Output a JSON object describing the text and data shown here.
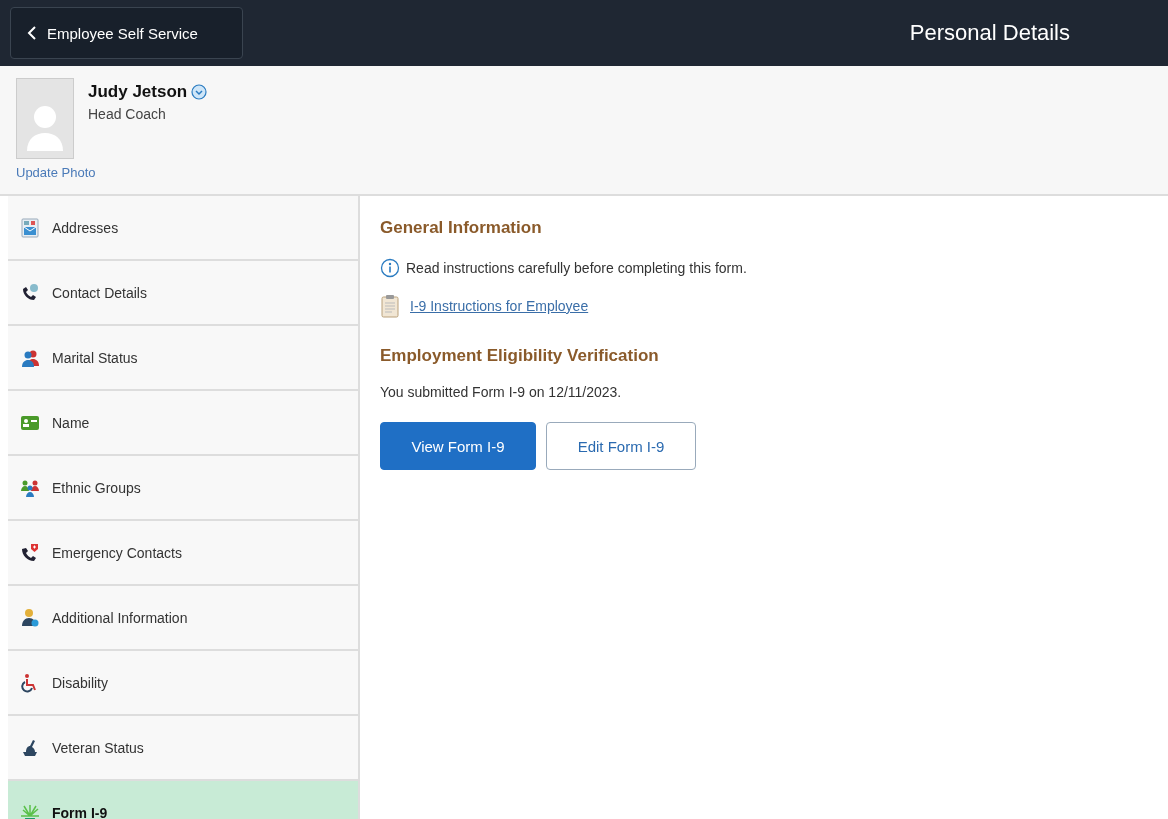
{
  "header": {
    "back_button": "Employee Self Service",
    "title": "Personal Details"
  },
  "profile": {
    "name": "Judy Jetson",
    "job_title": "Head Coach",
    "update_photo": "Update Photo"
  },
  "sidebar": {
    "items": [
      {
        "label": "Addresses",
        "selected": false
      },
      {
        "label": "Contact Details",
        "selected": false
      },
      {
        "label": "Marital Status",
        "selected": false
      },
      {
        "label": "Name",
        "selected": false
      },
      {
        "label": "Ethnic Groups",
        "selected": false
      },
      {
        "label": "Emergency Contacts",
        "selected": false
      },
      {
        "label": "Additional Information",
        "selected": false
      },
      {
        "label": "Disability",
        "selected": false
      },
      {
        "label": "Veteran Status",
        "selected": false
      },
      {
        "label": "Form I-9",
        "selected": true
      }
    ]
  },
  "content": {
    "general_heading": "General Information",
    "instruction_note": "Read instructions carefully before completing this form.",
    "instructions_link": "I-9 Instructions for Employee",
    "eligibility_heading": "Employment Eligibility Verification",
    "submitted_text": "You submitted Form I-9 on 12/11/2023.",
    "buttons": [
      {
        "label": "View Form I-9",
        "kind": "primary"
      },
      {
        "label": "Edit Form I-9",
        "kind": "secondary"
      }
    ]
  }
}
